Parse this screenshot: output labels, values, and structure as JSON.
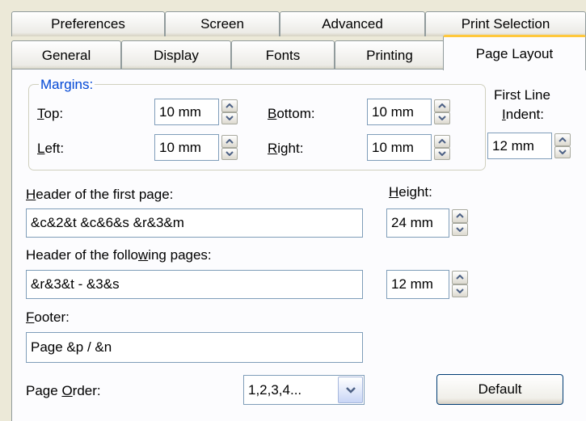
{
  "tabs_row1": [
    "Preferences",
    "Screen",
    "Advanced",
    "Print Selection"
  ],
  "tabs_row2": [
    "General",
    "Display",
    "Fonts",
    "Printing",
    "Page Layout"
  ],
  "active_tab": "Page Layout",
  "margins": {
    "legend": "Margins:",
    "top": {
      "key": "T",
      "rest": "op:",
      "value": "10 mm"
    },
    "left": {
      "key": "L",
      "rest": "eft:",
      "value": "10 mm"
    },
    "bottom": {
      "key": "B",
      "rest": "ottom:",
      "value": "10 mm"
    },
    "right": {
      "key": "R",
      "rest": "ight:",
      "value": "10 mm"
    }
  },
  "first_line_indent": {
    "line1": "First Line",
    "key": "I",
    "rest": "ndent:",
    "value": "12 mm"
  },
  "header_first": {
    "key": "H",
    "rest": "eader of the first page:",
    "value": "&c&2&t &c&6&s &r&3&m"
  },
  "height": {
    "key": "H",
    "rest": "eight:",
    "first_value": "24 mm",
    "following_value": "12 mm"
  },
  "header_following": {
    "before": "Header of the follo",
    "key": "w",
    "after": "ing pages:",
    "value": "&r&3&t - &3&s"
  },
  "footer": {
    "key": "F",
    "rest": "ooter:",
    "value": "Page &p / &n"
  },
  "page_order": {
    "before": "Page ",
    "key": "O",
    "after": "rder:",
    "value": "1,2,3,4..."
  },
  "default_button": "Default"
}
